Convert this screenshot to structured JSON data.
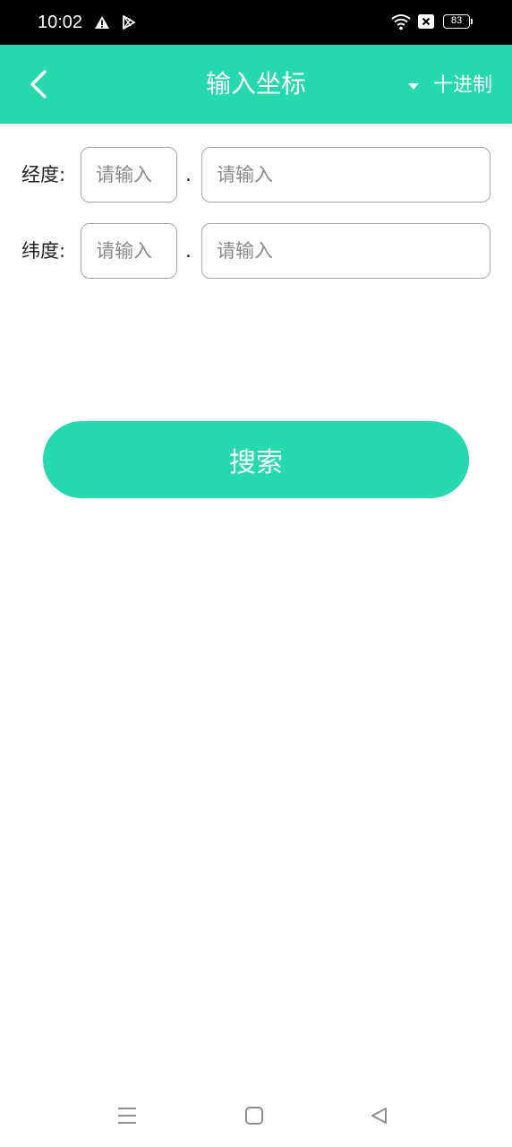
{
  "status_bar": {
    "time": "10:02",
    "battery": "83",
    "icons": [
      "warning-icon",
      "play-store-icon",
      "wifi-icon",
      "sim-error-icon",
      "battery-icon"
    ]
  },
  "app_bar": {
    "title": "输入坐标",
    "mode_label": "十进制",
    "back_icon": "chevron-left-icon",
    "dropdown_icon": "caret-down-icon",
    "background": "#25d8ad"
  },
  "form": {
    "longitude": {
      "label": "经度:",
      "integer_placeholder": "请输入",
      "integer_value": "",
      "separator": ".",
      "decimal_placeholder": "请输入",
      "decimal_value": ""
    },
    "latitude": {
      "label": "纬度:",
      "integer_placeholder": "请输入",
      "integer_value": "",
      "separator": ".",
      "decimal_placeholder": "请输入",
      "decimal_value": ""
    }
  },
  "search_button": {
    "label": "搜索",
    "color": "#25d8ad"
  },
  "nav_bar": {
    "icons": [
      "menu-icon",
      "home-icon",
      "back-triangle-icon"
    ]
  }
}
